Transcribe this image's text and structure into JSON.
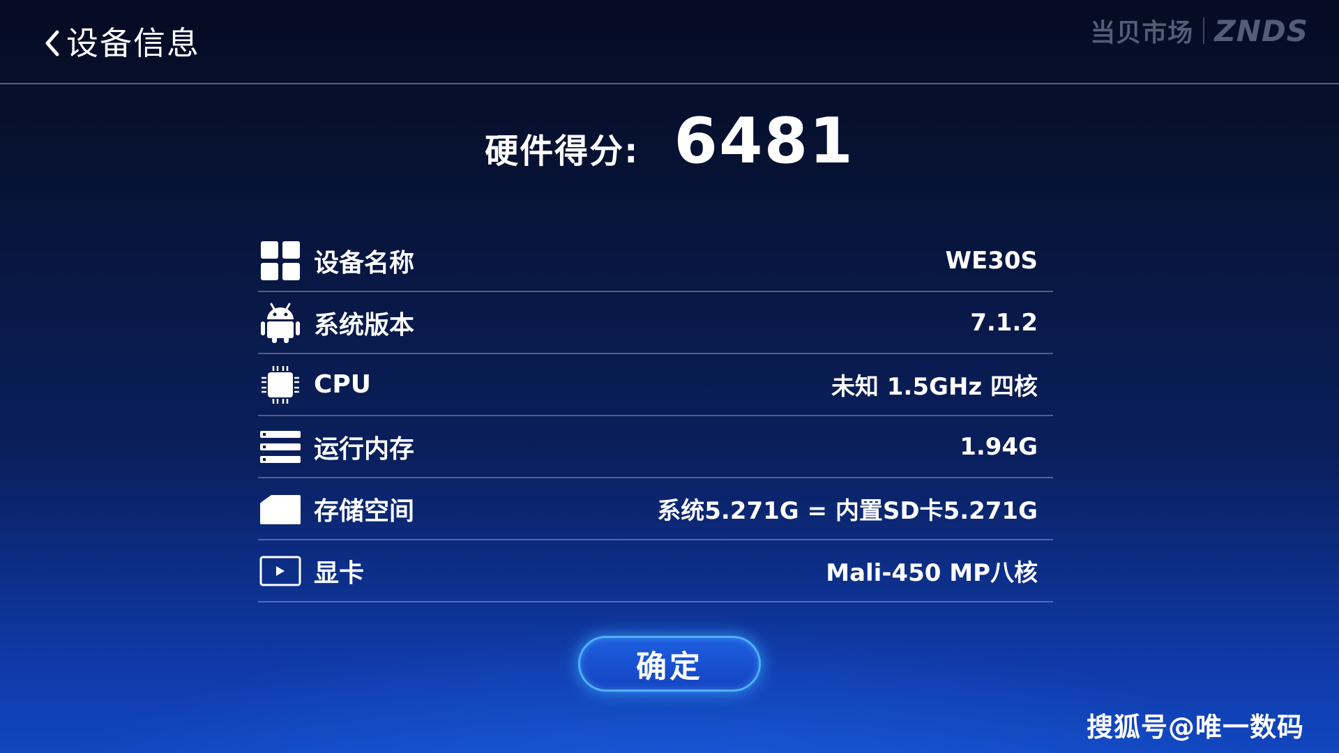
{
  "header": {
    "back_label": "设备信息",
    "logo_cn": "当贝市场",
    "logo_en": "ZNDS"
  },
  "score": {
    "label": "硬件得分:",
    "value": "6481"
  },
  "items": [
    {
      "icon": "grid-icon",
      "label": "设备名称",
      "value": "WE30S"
    },
    {
      "icon": "android-icon",
      "label": "系统版本",
      "value": "7.1.2"
    },
    {
      "icon": "cpu-chip-icon",
      "label": "CPU",
      "value": "未知 1.5GHz 四核"
    },
    {
      "icon": "memory-icon",
      "label": "运行内存",
      "value": "1.94G"
    },
    {
      "icon": "folder-icon",
      "label": "存储空间",
      "value": "系统5.271G = 内置SD卡5.271G"
    },
    {
      "icon": "play-screen-icon",
      "label": "显卡",
      "value": "Mali-450 MP八核"
    }
  ],
  "confirm_label": "确定",
  "watermark": "搜狐号@唯一数码",
  "colors": {
    "accent": "#4fb4ff",
    "button": "#1a55d8"
  }
}
